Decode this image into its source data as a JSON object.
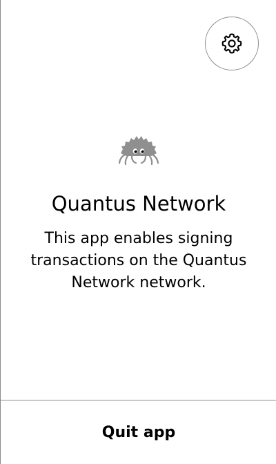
{
  "header": {
    "settings_icon": "gear-icon"
  },
  "main": {
    "mascot_icon": "crab-icon",
    "title": "Quantus Network",
    "description": "This app enables signing transactions on the Quantus Network network."
  },
  "footer": {
    "quit_label": "Quit app"
  },
  "colors": {
    "background": "#ffffff",
    "text": "#000000",
    "border": "#8a8a8a",
    "mascot": "#8f8f8f"
  }
}
